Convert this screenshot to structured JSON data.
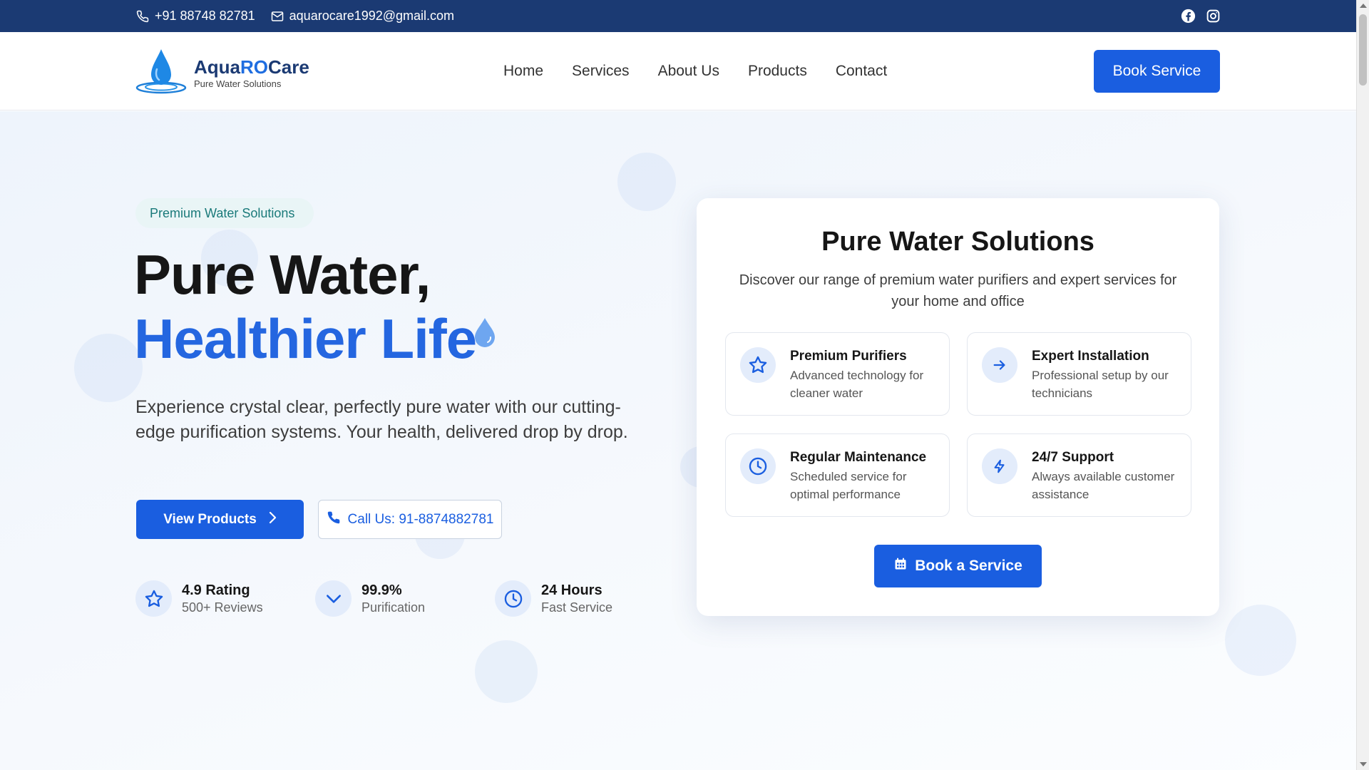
{
  "colors": {
    "topbar": "#1b3a73",
    "primary": "#1a5ee0",
    "accent_text": "#2466e0",
    "pill_text": "#1a7a7a"
  },
  "topbar": {
    "phone": "+91 88748 82781",
    "email": "aquarocare1992@gmail.com",
    "phone_icon": "phone-icon",
    "email_icon": "mail-icon",
    "social": [
      "facebook-icon",
      "instagram-icon"
    ]
  },
  "nav": {
    "logo": {
      "brand_part1": "Aqua",
      "brand_part2": "RO",
      "brand_part3": "Care",
      "tagline": "Pure Water Solutions"
    },
    "links": [
      "Home",
      "Services",
      "About Us",
      "Products",
      "Contact"
    ],
    "cta": "Book Service"
  },
  "hero": {
    "pill": "Premium Water Solutions",
    "headline_line1": "Pure Water,",
    "headline_line2": "Healthier Life",
    "lead": "Experience crystal clear, perfectly pure water with our cutting-edge purification systems. Your health, delivered drop by drop.",
    "primary_button": "View Products",
    "secondary_button": "Call Us: 91-8874882781",
    "stats": [
      {
        "icon": "star-icon",
        "value": "4.9 Rating",
        "label": "500+ Reviews"
      },
      {
        "icon": "check-icon",
        "value": "99.9%",
        "label": "Purification"
      },
      {
        "icon": "clock-icon",
        "value": "24 Hours",
        "label": "Fast Service"
      }
    ]
  },
  "card": {
    "title": "Pure Water Solutions",
    "description": "Discover our range of premium water purifiers and expert services for your home and office",
    "features": [
      {
        "icon": "star-icon",
        "title": "Premium Purifiers",
        "desc": "Advanced technology for cleaner water"
      },
      {
        "icon": "arrow-right-icon",
        "title": "Expert Installation",
        "desc": "Professional setup by our technicians"
      },
      {
        "icon": "clock-icon",
        "title": "Regular Maintenance",
        "desc": "Scheduled service for optimal performance"
      },
      {
        "icon": "bolt-icon",
        "title": "24/7 Support",
        "desc": "Always available customer assistance"
      }
    ],
    "button": "Book a Service"
  }
}
